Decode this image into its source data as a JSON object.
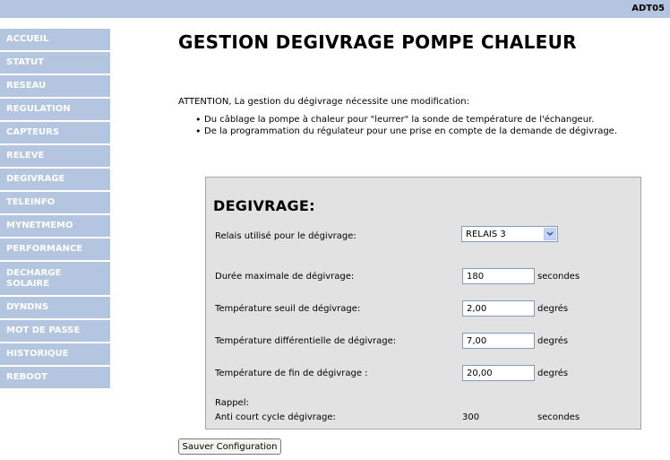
{
  "header": {
    "device": "ADT05"
  },
  "sidebar": {
    "items": [
      {
        "label": "ACCUEIL"
      },
      {
        "label": "STATUT"
      },
      {
        "label": "RESEAU"
      },
      {
        "label": "REGULATION"
      },
      {
        "label": "CAPTEURS"
      },
      {
        "label": "RELEVE"
      },
      {
        "label": "DEGIVRAGE"
      },
      {
        "label": "TELEINFO"
      },
      {
        "label": "MYNETMEMO"
      },
      {
        "label": "PERFORMANCE"
      },
      {
        "label": "DECHARGE\nSOLAIRE"
      },
      {
        "label": "DYNDNS"
      },
      {
        "label": "MOT DE PASSE"
      },
      {
        "label": "HISTORIQUE"
      },
      {
        "label": "REBOOT"
      }
    ]
  },
  "main": {
    "title": "GESTION DEGIVRAGE POMPE CHALEUR",
    "attention": "ATTENTION, La gestion du dégivrage nécessite une modification:",
    "bullets": [
      "Du câblage la pompe à chaleur pour \"leurrer\" la sonde de température de l'échangeur.",
      "De la programmation du régulateur pour une prise en compte de la demande de dégivrage."
    ]
  },
  "panel": {
    "title": "DEGIVRAGE:",
    "relay_label": "Relais utilisé pour le dégivrage:",
    "relay_value": "RELAIS 3",
    "fields": [
      {
        "label": "Durée maximale de dégivrage:",
        "value": "180",
        "unit": "secondes"
      },
      {
        "label": "Température seuil de dégivrage:",
        "value": "2,00",
        "unit": "degrés"
      },
      {
        "label": "Température différentielle de dégivrage:",
        "value": "7,00",
        "unit": "degrés"
      },
      {
        "label": "Température de fin de dégivrage :",
        "value": "20,00",
        "unit": "degrés"
      }
    ],
    "reminder_label": "Rappel:",
    "anti_cycle_label": "Anti court cycle dégivrage:",
    "anti_cycle_value": "300",
    "anti_cycle_unit": "secondes"
  },
  "actions": {
    "save_label": "Sauver Configuration"
  }
}
